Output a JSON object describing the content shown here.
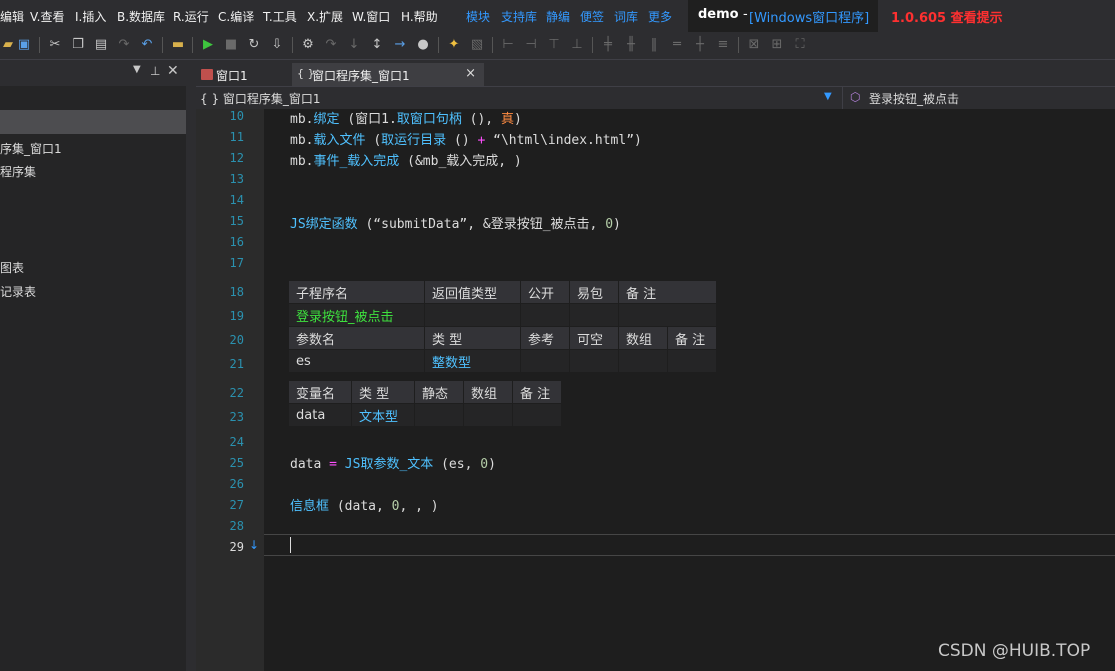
{
  "menu": [
    "编辑",
    "V.查看",
    "I.插入",
    "B.数据库",
    "R.运行",
    "C.编译",
    "T.工具",
    "X.扩展",
    "W.窗口",
    "H.帮助"
  ],
  "links": [
    "模块",
    "支持库",
    "静编",
    "便签",
    "词库",
    "更多"
  ],
  "title": {
    "name": "demo",
    "sep": "-",
    "program": "[Windows窗口程序]"
  },
  "version": "1.0.605 查看提示",
  "left_panel": {
    "dropdown_icon": "chevron-down-icon",
    "items": [
      "序集_窗口1",
      "程序集",
      "图表",
      "记录表"
    ]
  },
  "tabs": [
    {
      "label": "窗口1",
      "icon": "window-form-icon"
    },
    {
      "label": "窗口程序集_窗口1",
      "icon": "code-braces-icon",
      "close": "×"
    }
  ],
  "navbar": {
    "left": "{ } 窗口程序集_窗口1",
    "right": "登录按钮_被点击"
  },
  "line_numbers": [
    "10",
    "11",
    "12",
    "13",
    "14",
    "15",
    "16",
    "17",
    "18",
    "19",
    "20",
    "21",
    "22",
    "23",
    "24",
    "25",
    "26",
    "27",
    "28",
    "29"
  ],
  "code": {
    "l10": {
      "a": "mb.",
      "b": "绑定",
      "c": " (窗口1.",
      "d": "取窗口句柄",
      "e": " (), ",
      "f": "真",
      "g": ")"
    },
    "l11": {
      "a": "mb.",
      "b": "载入文件",
      "c": " (",
      "d": "取运行目录",
      "e": " () ",
      "f": "+",
      "g": " “\\html\\index.html”)"
    },
    "l12": {
      "a": "mb.",
      "b": "事件_载入完成",
      "c": " (&mb_载入完成, )"
    },
    "l15": {
      "a": "JS绑定函数",
      "b": " (“submitData”, &登录按钮_被点击, ",
      "c": "0",
      "d": ")"
    },
    "l25": {
      "a": "data ",
      "b": "=",
      "c": " ",
      "d": "JS取参数_文本",
      "e": " (es, ",
      "f": "0",
      "g": ")"
    },
    "l27": {
      "a": "信息框",
      "b": " (data, ",
      "c": "0",
      "d": ", , )"
    }
  },
  "sub_table": {
    "header1": [
      "子程序名",
      "返回值类型",
      "公开",
      "易包",
      "备 注"
    ],
    "row1": [
      "登录按钮_被点击",
      "",
      "",
      "",
      ""
    ],
    "header2": [
      "参数名",
      "类 型",
      "参考",
      "可空",
      "数组",
      "备 注"
    ],
    "row2": [
      "es",
      "整数型",
      "",
      "",
      "",
      ""
    ]
  },
  "var_table": {
    "header": [
      "变量名",
      "类 型",
      "静态",
      "数组",
      "备 注"
    ],
    "row": [
      "data",
      "文本型",
      "",
      "",
      ""
    ]
  },
  "watermark": "CSDN @HUIB.TOP",
  "colors": {
    "keyword": "#4fc1ff",
    "sub_name": "#3ee03e",
    "version": "#ff3030",
    "link": "#3399ff"
  }
}
